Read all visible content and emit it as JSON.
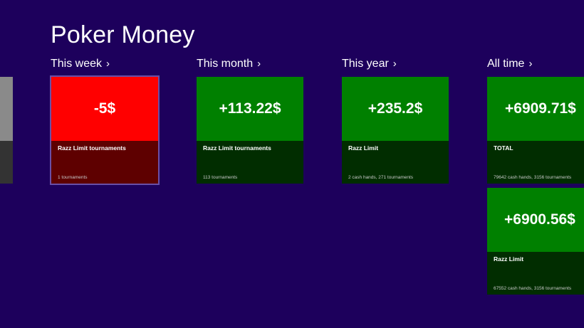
{
  "app": {
    "title": "Poker Money"
  },
  "groups": [
    {
      "header": "This week",
      "tiles": [
        {
          "amount": "-5$",
          "label": "Razz Limit tournaments",
          "detail": "1 tournaments",
          "color": "#ff0000"
        }
      ]
    },
    {
      "header": "This month",
      "tiles": [
        {
          "amount": "+113.22$",
          "label": "Razz Limit tournaments",
          "detail": "113 tournaments",
          "color": "#008000"
        }
      ]
    },
    {
      "header": "This year",
      "tiles": [
        {
          "amount": "+235.2$",
          "label": "Razz Limit",
          "detail": "2 cash hands, 271 tournaments",
          "color": "#008000"
        }
      ]
    },
    {
      "header": "All time",
      "tiles": [
        {
          "amount": "+6909.71$",
          "label": "TOTAL",
          "detail": "79642 cash hands, 3156 tournaments",
          "color": "#008000"
        },
        {
          "amount": "+6900.56$",
          "label": "Razz Limit",
          "detail": "67552 cash hands, 3156 tournaments",
          "color": "#008000"
        }
      ]
    }
  ],
  "header_chevron": "›",
  "colors": {
    "background": "#1d005c",
    "positive": "#008000",
    "negative": "#ff0000"
  }
}
